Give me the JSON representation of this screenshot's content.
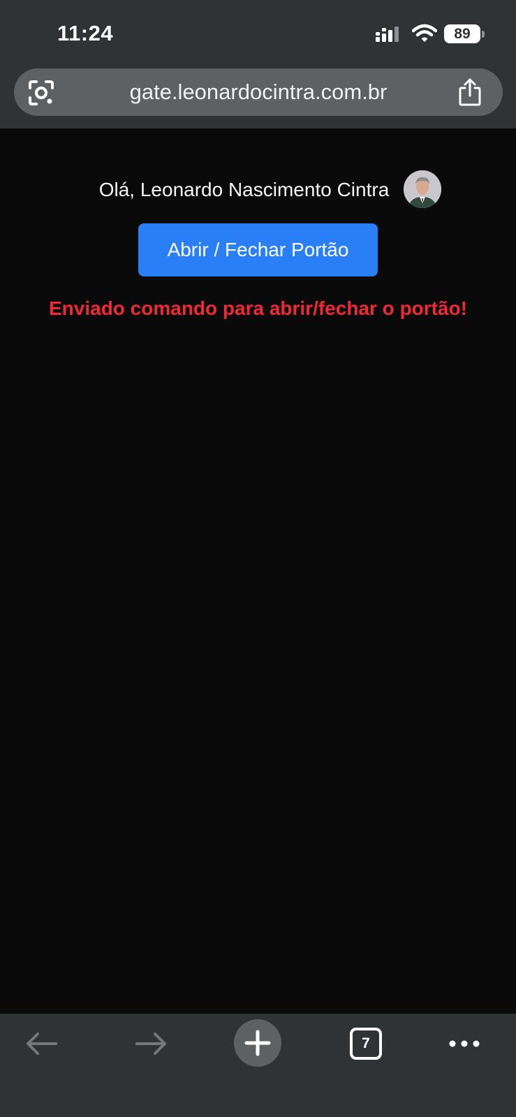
{
  "status_bar": {
    "time": "11:24",
    "battery": "89",
    "icons": [
      "cellular-signal-icon",
      "wifi-icon",
      "battery-icon"
    ]
  },
  "browser": {
    "url": "gate.leonardocintra.com.br",
    "tab_count": "7",
    "icons": [
      "camera-lens-icon",
      "share-icon",
      "back-arrow-icon",
      "forward-arrow-icon",
      "plus-icon",
      "more-icon"
    ]
  },
  "page": {
    "greeting": "Olá, Leonardo Nascimento Cintra",
    "gate_button_label": "Abrir / Fechar Portão",
    "status_message": "Enviado comando para abrir/fechar o portão!"
  },
  "colors": {
    "background": "#0a0a0b",
    "chrome": "#303336",
    "url_bar": "#5d6164",
    "button": "#2b7ff6",
    "message": "#ee2a36"
  }
}
